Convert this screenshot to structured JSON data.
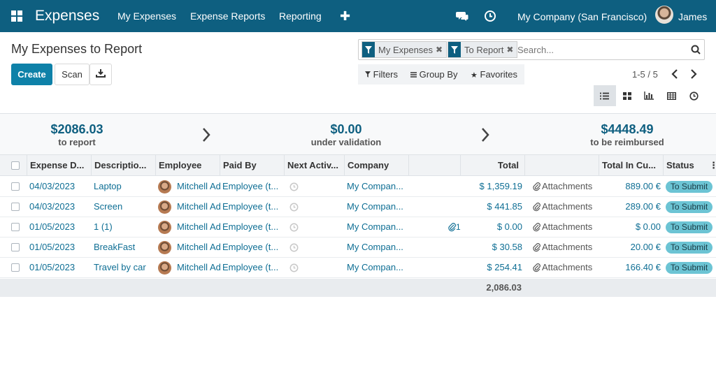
{
  "navbar": {
    "app_title": "Expenses",
    "menu": [
      "My Expenses",
      "Expense Reports",
      "Reporting"
    ],
    "company": "My Company (San Francisco)",
    "user": "James",
    "bg_color": "#0e5f80"
  },
  "control": {
    "title": "My Expenses to Report",
    "create_label": "Create",
    "scan_label": "Scan",
    "search": {
      "facets": [
        "My Expenses",
        "To Report"
      ],
      "placeholder": "Search..."
    },
    "filters_label": "Filters",
    "groupby_label": "Group By",
    "favorites_label": "Favorites",
    "pager": "1-5 / 5",
    "views": [
      "list-view-icon",
      "kanban-view-icon",
      "graph-view-icon",
      "pivot-view-icon",
      "activity-view-icon"
    ]
  },
  "summary": [
    {
      "amount": "$2086.03",
      "label": "to report"
    },
    {
      "amount": "$0.00",
      "label": "under validation"
    },
    {
      "amount": "$4448.49",
      "label": "to be reimbursed"
    }
  ],
  "table": {
    "headers": {
      "date": "Expense D...",
      "description": "Descriptio...",
      "employee": "Employee",
      "paid_by": "Paid By",
      "next_activity": "Next Activ...",
      "company": "Company",
      "total": "Total",
      "total_currency": "Total In Cu...",
      "status": "Status"
    },
    "rows": [
      {
        "date": "04/03/2023",
        "description": "Laptop",
        "employee": "Mitchell Ad",
        "paid_by": "Employee (t...",
        "company": "My Compan...",
        "attach_count": "",
        "total": "$ 1,359.19",
        "attachments": "Attachments",
        "total_currency": "889.00 €",
        "status": "To Submit"
      },
      {
        "date": "04/03/2023",
        "description": "Screen",
        "employee": "Mitchell Ad",
        "paid_by": "Employee (t...",
        "company": "My Compan...",
        "attach_count": "",
        "total": "$ 441.85",
        "attachments": "Attachments",
        "total_currency": "289.00 €",
        "status": "To Submit"
      },
      {
        "date": "01/05/2023",
        "description": "1 (1)",
        "employee": "Mitchell Ad",
        "paid_by": "Employee (t...",
        "company": "My Compan...",
        "attach_count": "1",
        "total": "$ 0.00",
        "attachments": "Attachments",
        "total_currency": "$ 0.00",
        "status": "To Submit"
      },
      {
        "date": "01/05/2023",
        "description": "BreakFast",
        "employee": "Mitchell Ad",
        "paid_by": "Employee (t...",
        "company": "My Compan...",
        "attach_count": "",
        "total": "$ 30.58",
        "attachments": "Attachments",
        "total_currency": "20.00 €",
        "status": "To Submit"
      },
      {
        "date": "01/05/2023",
        "description": "Travel by car",
        "employee": "Mitchell Ad",
        "paid_by": "Employee (t...",
        "company": "My Compan...",
        "attach_count": "",
        "total": "$ 254.41",
        "attachments": "Attachments",
        "total_currency": "166.40 €",
        "status": "To Submit"
      }
    ],
    "footer_total": "2,086.03"
  }
}
